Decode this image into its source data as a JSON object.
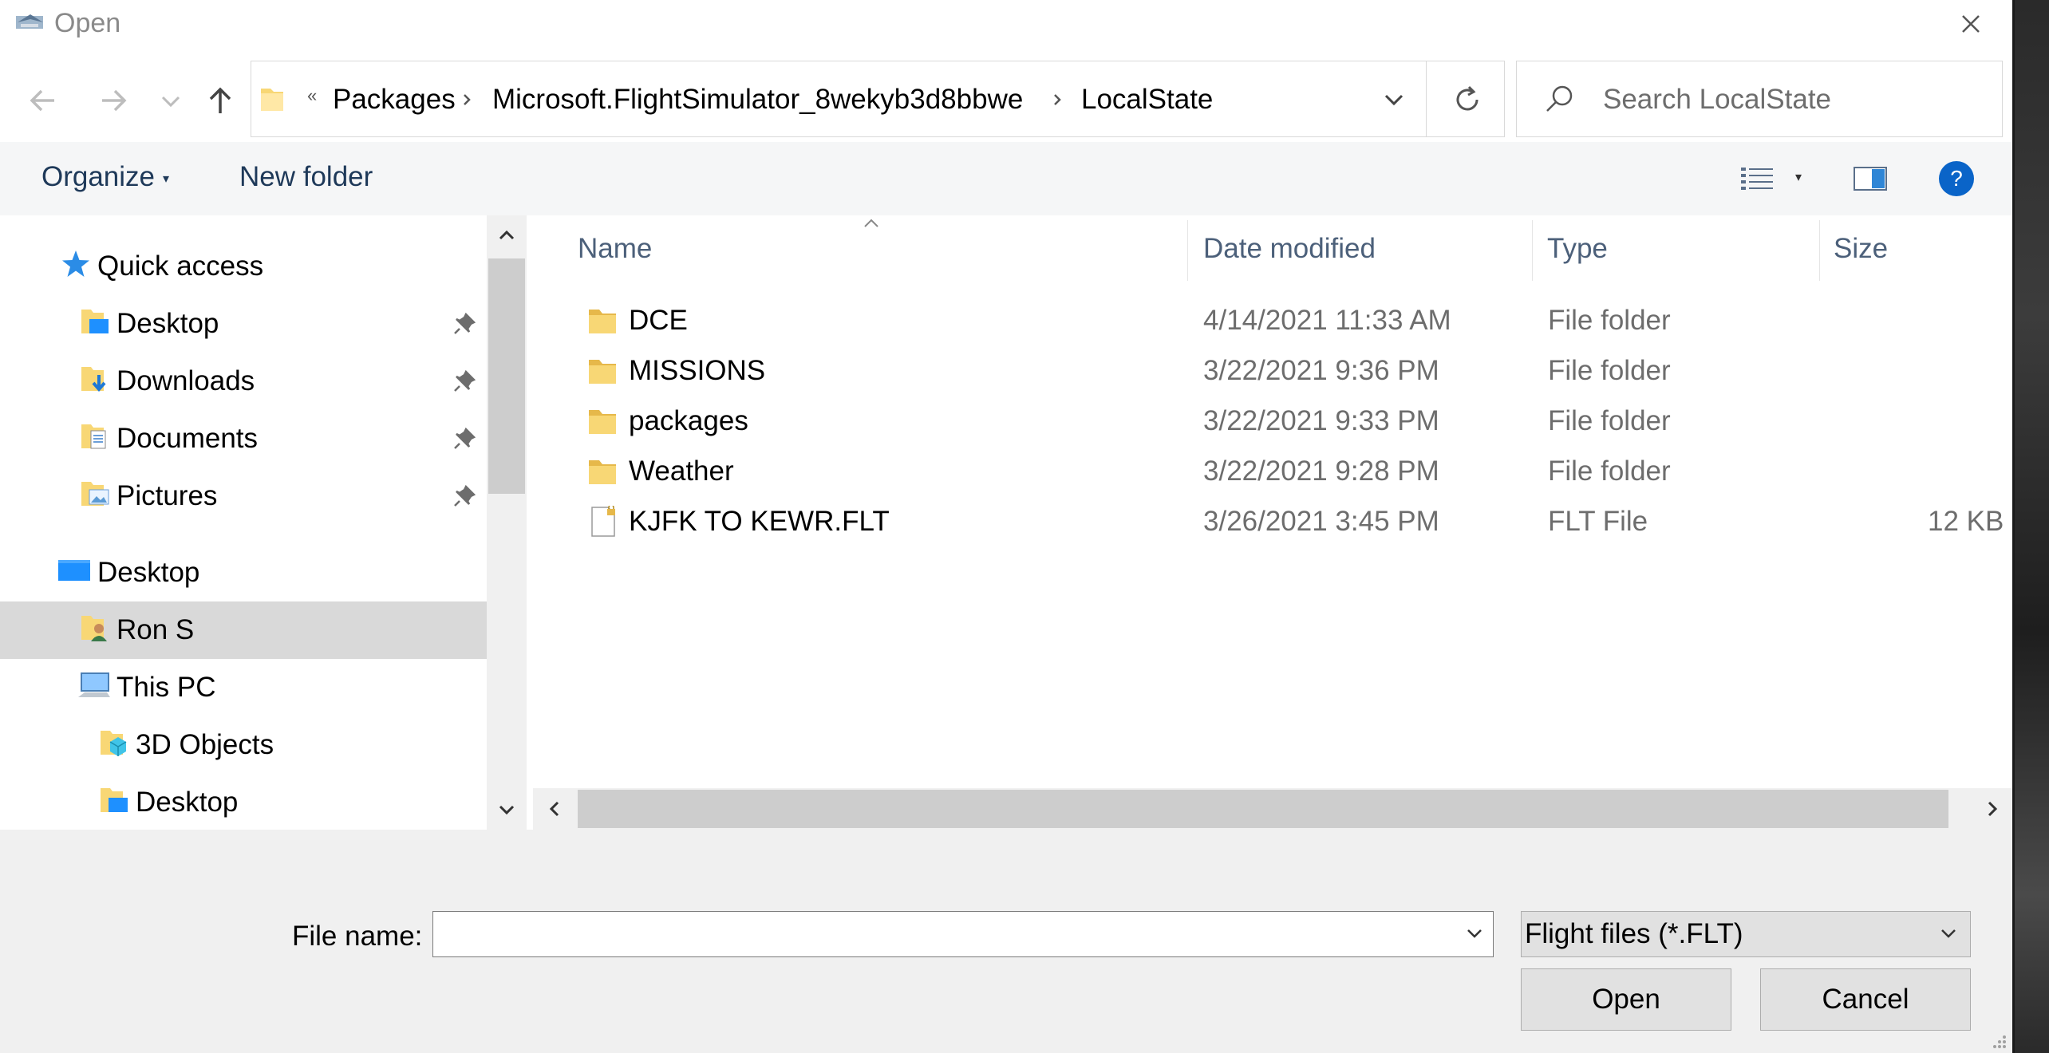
{
  "window": {
    "title": "Open"
  },
  "address": {
    "overflow": "«",
    "crumbs": [
      "Packages",
      "Microsoft.FlightSimulator_8wekyb3d8bbwe",
      "LocalState"
    ]
  },
  "search": {
    "placeholder": "Search LocalState"
  },
  "toolbar": {
    "organize": "Organize",
    "new_folder": "New folder"
  },
  "nav": {
    "items": [
      {
        "label": "Quick access",
        "icon": "star-icon"
      },
      {
        "label": "Desktop",
        "icon": "desktop-folder-icon",
        "pinned": true
      },
      {
        "label": "Downloads",
        "icon": "downloads-folder-icon",
        "pinned": true
      },
      {
        "label": "Documents",
        "icon": "documents-folder-icon",
        "pinned": true
      },
      {
        "label": "Pictures",
        "icon": "pictures-folder-icon",
        "pinned": true
      },
      {
        "label": "Desktop",
        "icon": "desktop-icon"
      },
      {
        "label": "Ron S",
        "icon": "user-folder-icon",
        "selected": true
      },
      {
        "label": "This PC",
        "icon": "computer-icon"
      },
      {
        "label": "3D Objects",
        "icon": "3d-objects-folder-icon"
      },
      {
        "label": "Desktop",
        "icon": "desktop-folder-icon"
      }
    ]
  },
  "columns": {
    "name": "Name",
    "date": "Date modified",
    "type": "Type",
    "size": "Size"
  },
  "files": [
    {
      "name": "DCE",
      "date": "4/14/2021 11:33 AM",
      "type": "File folder",
      "size": "",
      "icon": "folder-icon"
    },
    {
      "name": "MISSIONS",
      "date": "3/22/2021 9:36 PM",
      "type": "File folder",
      "size": "",
      "icon": "folder-icon"
    },
    {
      "name": "packages",
      "date": "3/22/2021 9:33 PM",
      "type": "File folder",
      "size": "",
      "icon": "folder-icon"
    },
    {
      "name": "Weather",
      "date": "3/22/2021 9:28 PM",
      "type": "File folder",
      "size": "",
      "icon": "folder-icon"
    },
    {
      "name": "KJFK TO KEWR.FLT",
      "date": "3/26/2021 3:45 PM",
      "type": "FLT File",
      "size": "12 KB",
      "icon": "file-locked-icon"
    }
  ],
  "footer": {
    "file_name_label": "File name:",
    "file_name_value": "",
    "filter": "Flight files (*.FLT)",
    "open": "Open",
    "cancel": "Cancel"
  },
  "colors": {
    "accent": "#0078d7",
    "selected_bg": "#d9d9d9",
    "folder": "#f8d775"
  }
}
